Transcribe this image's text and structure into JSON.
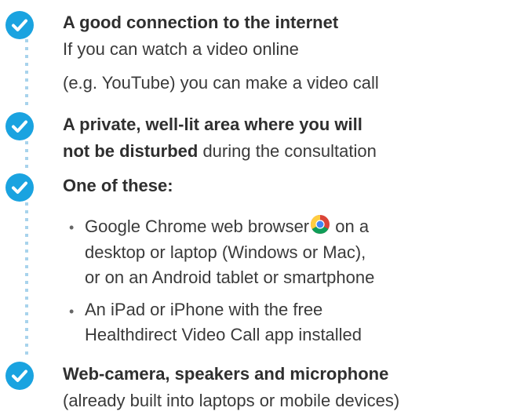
{
  "items": [
    {
      "title": "A good connection to the internet",
      "lines": [
        "If you can watch a video online",
        "(e.g. YouTube) you can make a video call"
      ]
    },
    {
      "title_lines": [
        "A private, well-lit area where you will",
        "not be disturbed"
      ],
      "suffix": " during the consultation"
    },
    {
      "title": "One of these:",
      "bullets": [
        {
          "line1_before_icon": "Google Chrome web browser",
          "line1_after_icon": " on a",
          "lines": [
            "desktop or laptop (Windows or Mac),",
            "or on an Android tablet or smartphone"
          ]
        },
        {
          "lines": [
            "An iPad or iPhone with the free",
            "Healthdirect Video Call app installed"
          ]
        }
      ]
    },
    {
      "title": "Web-camera, speakers and microphone",
      "lines": [
        "(already built into laptops or mobile devices)"
      ]
    }
  ],
  "icons": {
    "check": "check-circle-icon",
    "browser": "chrome-icon",
    "bullet": "•"
  },
  "colors": {
    "accent": "#1aa3e0",
    "dots": "#a8d3ec",
    "text": "#3a3a3a"
  }
}
